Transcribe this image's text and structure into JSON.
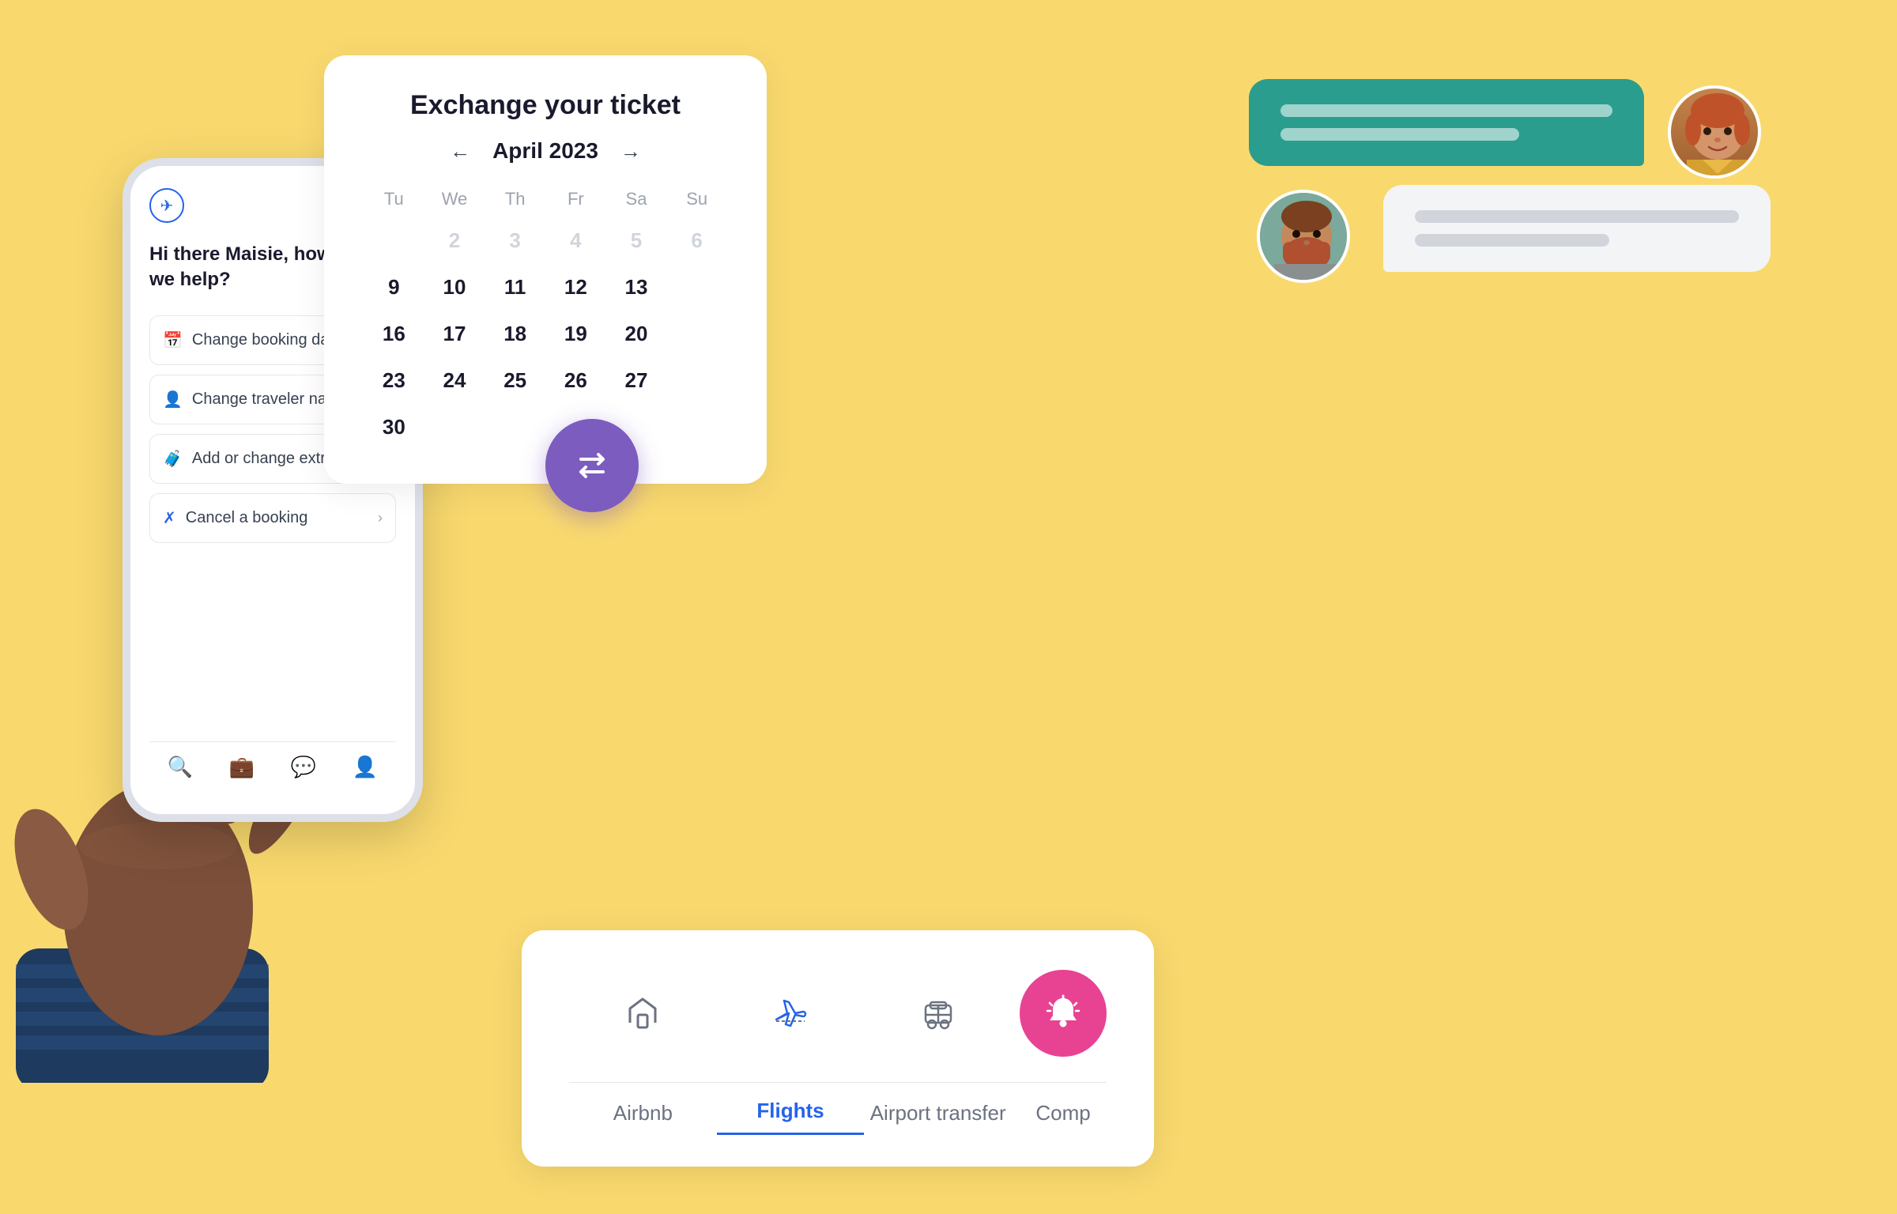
{
  "background_color": "#F9D96E",
  "phone": {
    "greeting": "Hi there Maisie, how can we help?",
    "menu_items": [
      {
        "id": "change-dates",
        "icon": "📅",
        "label": "Change booking dates",
        "has_arrow": true
      },
      {
        "id": "change-name",
        "icon": "👤",
        "label": "Change traveler name(s)",
        "has_arrow": true
      },
      {
        "id": "add-extras",
        "icon": "🧳",
        "label": "Add or change extras",
        "has_arrow": false
      },
      {
        "id": "cancel",
        "icon": "❌",
        "label": "Cancel a booking",
        "has_arrow": true
      }
    ],
    "nav_items": [
      "🔍",
      "💼",
      "💬",
      "👤"
    ]
  },
  "calendar": {
    "title": "Exchange your ticket",
    "month": "April 2023",
    "day_headers": [
      "Tu",
      "We",
      "Th",
      "Fr",
      "Sa",
      "Su"
    ],
    "weeks": [
      [
        "",
        "2",
        "3",
        "4",
        "5",
        "6"
      ],
      [
        "9",
        "10",
        "11",
        "12",
        "13",
        ""
      ],
      [
        "16",
        "17",
        "18",
        "19",
        "20",
        ""
      ],
      [
        "23",
        "24",
        "25",
        "26",
        "27",
        ""
      ],
      [
        "30",
        "",
        "",
        "",
        "",
        ""
      ]
    ]
  },
  "exchange_btn": {
    "icon": "⇄",
    "color": "#7c5cbf"
  },
  "chat": {
    "agent_bubble_lines": [
      2,
      1
    ],
    "user_bubble_lines": [
      1,
      1
    ]
  },
  "bottom_card": {
    "tabs": [
      {
        "id": "airbnb",
        "label": "Airbnb",
        "icon": "✈",
        "active": false
      },
      {
        "id": "flights",
        "label": "Flights",
        "icon": "✈",
        "active": true
      },
      {
        "id": "airport-transfer",
        "label": "Airport transfer",
        "icon": "🚇",
        "active": false
      },
      {
        "id": "comp",
        "label": "Comp",
        "icon": "🔔",
        "active": false,
        "special": true
      }
    ]
  }
}
